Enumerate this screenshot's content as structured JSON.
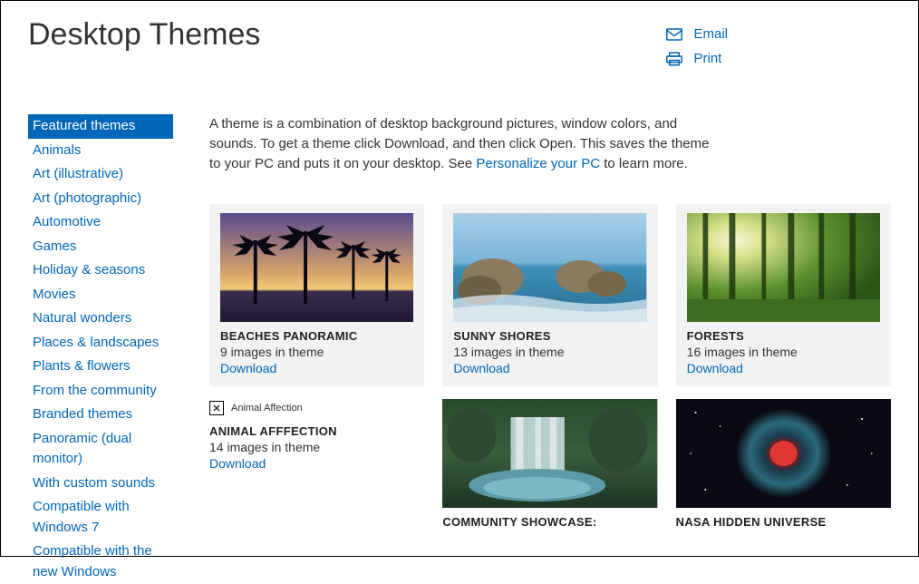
{
  "header": {
    "title": "Desktop Themes",
    "email_label": "Email",
    "print_label": "Print"
  },
  "sidebar": {
    "items": [
      {
        "label": "Featured themes",
        "active": true
      },
      {
        "label": "Animals",
        "active": false
      },
      {
        "label": "Art (illustrative)",
        "active": false
      },
      {
        "label": "Art (photographic)",
        "active": false
      },
      {
        "label": "Automotive",
        "active": false
      },
      {
        "label": "Games",
        "active": false
      },
      {
        "label": "Holiday & seasons",
        "active": false
      },
      {
        "label": "Movies",
        "active": false
      },
      {
        "label": "Natural wonders",
        "active": false
      },
      {
        "label": "Places & landscapes",
        "active": false
      },
      {
        "label": "Plants & flowers",
        "active": false
      },
      {
        "label": "From the community",
        "active": false
      },
      {
        "label": "Branded themes",
        "active": false
      },
      {
        "label": "Panoramic (dual monitor)",
        "active": false
      },
      {
        "label": "With custom sounds",
        "active": false
      },
      {
        "label": "Compatible with Windows 7",
        "active": false
      },
      {
        "label": "Compatible with the new Windows",
        "active": false
      }
    ]
  },
  "intro": {
    "text_before": "A theme is a combination of desktop background pictures, window colors, and sounds. To get a theme click Download, and then click Open. This saves the theme to your PC and puts it on your desktop. See ",
    "link": "Personalize your PC",
    "text_after": " to learn more."
  },
  "themes": [
    {
      "title": "BEACHES PANORAMIC",
      "count": "9 images in theme",
      "download": "Download",
      "featured": true
    },
    {
      "title": "SUNNY SHORES",
      "count": "13 images in theme",
      "download": "Download",
      "featured": true
    },
    {
      "title": "FORESTS",
      "count": "16 images in theme",
      "download": "Download",
      "featured": true
    },
    {
      "title": "ANIMAL AFFFECTION",
      "alt": "Animal Affection",
      "count": "14 images in theme",
      "download": "Download",
      "featured": false,
      "broken": true
    },
    {
      "title": "COMMUNITY SHOWCASE:",
      "count": "",
      "download": "",
      "featured": false
    },
    {
      "title": "NASA HIDDEN UNIVERSE",
      "count": "",
      "download": "",
      "featured": false
    }
  ]
}
